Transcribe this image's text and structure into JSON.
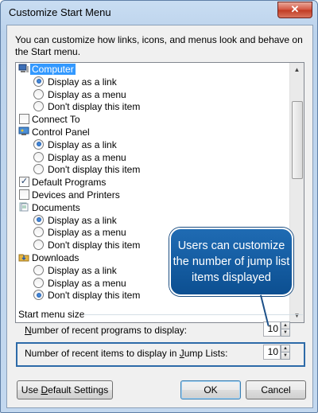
{
  "window": {
    "title": "Customize Start Menu",
    "close_glyph": "✕"
  },
  "intro_text": "You can customize how links, icons, and menus look and behave on the Start menu.",
  "list": {
    "rows": [
      {
        "kind": "icon",
        "icon": "computer-icon",
        "label": "Computer",
        "selected": true
      },
      {
        "kind": "radio",
        "label": "Display as a link",
        "checked": true
      },
      {
        "kind": "radio",
        "label": "Display as a menu",
        "checked": false
      },
      {
        "kind": "radio",
        "label": "Don't display this item",
        "checked": false
      },
      {
        "kind": "check",
        "label": "Connect To",
        "checked": false
      },
      {
        "kind": "icon",
        "icon": "control-panel-icon",
        "label": "Control Panel"
      },
      {
        "kind": "radio",
        "label": "Display as a link",
        "checked": true
      },
      {
        "kind": "radio",
        "label": "Display as a menu",
        "checked": false
      },
      {
        "kind": "radio",
        "label": "Don't display this item",
        "checked": false
      },
      {
        "kind": "check",
        "label": "Default Programs",
        "checked": true
      },
      {
        "kind": "check",
        "label": "Devices and Printers",
        "checked": false
      },
      {
        "kind": "icon",
        "icon": "documents-icon",
        "label": "Documents"
      },
      {
        "kind": "radio",
        "label": "Display as a link",
        "checked": true
      },
      {
        "kind": "radio",
        "label": "Display as a menu",
        "checked": false
      },
      {
        "kind": "radio",
        "label": "Don't display this item",
        "checked": false
      },
      {
        "kind": "icon",
        "icon": "downloads-icon",
        "label": "Downloads"
      },
      {
        "kind": "radio",
        "label": "Display as a link",
        "checked": false
      },
      {
        "kind": "radio",
        "label": "Display as a menu",
        "checked": false
      },
      {
        "kind": "radio",
        "label": "Don't display this item",
        "checked": true
      }
    ]
  },
  "size_group": {
    "title": "Start menu size",
    "recent_programs_label_pre": "",
    "recent_programs_label_u": "N",
    "recent_programs_label_post": "umber of recent programs to display:",
    "recent_programs_value": "10",
    "recent_items_label_pre": "Number of recent items to display in ",
    "recent_items_label_u": "J",
    "recent_items_label_post": "ump Lists:",
    "recent_items_value": "10"
  },
  "buttons": {
    "defaults_pre": "Use ",
    "defaults_u": "D",
    "defaults_post": "efault Settings",
    "ok": "OK",
    "cancel": "Cancel"
  },
  "callout": "Users can customize the number of jump list items displayed",
  "colors": {
    "selection": "#3399ff",
    "callout": "#1a62aa",
    "highlight_border": "#2d6aa8"
  }
}
